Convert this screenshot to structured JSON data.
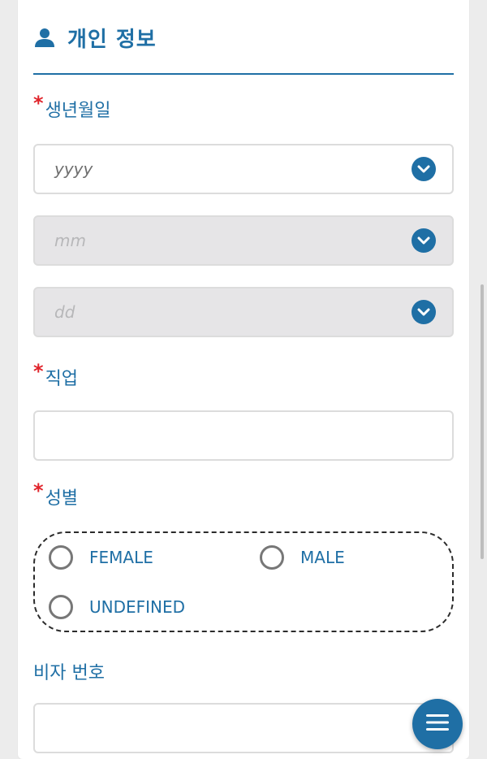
{
  "section": {
    "title": "개인 정보",
    "icon": "person-icon"
  },
  "fields": {
    "birthdate": {
      "label": "생년월일",
      "required_mark": "*",
      "year_placeholder": "yyyy",
      "month_placeholder": "mm",
      "day_placeholder": "dd"
    },
    "occupation": {
      "label": "직업",
      "required_mark": "*",
      "value": ""
    },
    "gender": {
      "label": "성별",
      "required_mark": "*",
      "options": [
        "FEMALE",
        "MALE",
        "UNDEFINED"
      ]
    },
    "visa_number": {
      "label": "비자 번호",
      "value": ""
    }
  },
  "fab": {
    "icon": "menu-icon"
  },
  "colors": {
    "accent": "#1f6fa5",
    "required": "#e0242b",
    "disabled_bg": "#e6e5e7",
    "page_bg": "#ececec"
  }
}
